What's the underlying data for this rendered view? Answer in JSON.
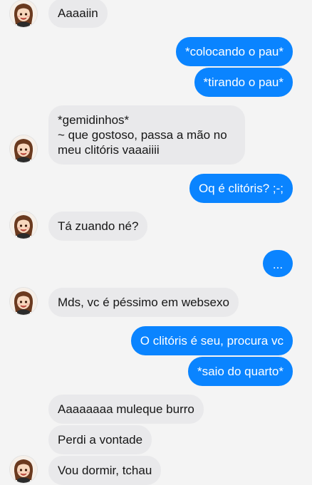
{
  "messages": [
    {
      "side": "in",
      "text": "Aaaaiin"
    },
    {
      "side": "out",
      "text": "*colocando o pau*"
    },
    {
      "side": "out",
      "text": "*tirando o pau*"
    },
    {
      "side": "in",
      "text": "*gemidinhos*\n~ que gostoso, passa a mão no\nmeu clitóris vaaaiiii"
    },
    {
      "side": "out",
      "text": "Oq é clitóris? ;-;"
    },
    {
      "side": "in",
      "text": "Tá zuando né?"
    },
    {
      "side": "out",
      "text": "..."
    },
    {
      "side": "in",
      "text": "Mds, vc é péssimo em websexo"
    },
    {
      "side": "out",
      "text": "O clitóris é seu, procura vc"
    },
    {
      "side": "out",
      "text": "*saio do quarto*"
    },
    {
      "side": "in",
      "text": "Aaaaaaaa muleque burro"
    },
    {
      "side": "in",
      "text": "Perdi a vontade"
    },
    {
      "side": "in",
      "text": "Vou dormir, tchau"
    }
  ],
  "avatar_icon": "anime-girl-avatar",
  "colors": {
    "background": "#f4f4f4",
    "incoming_bubble": "#e9e9eb",
    "outgoing_bubble": "#0a84ff",
    "incoming_text": "#161616",
    "outgoing_text": "#ffffff"
  }
}
